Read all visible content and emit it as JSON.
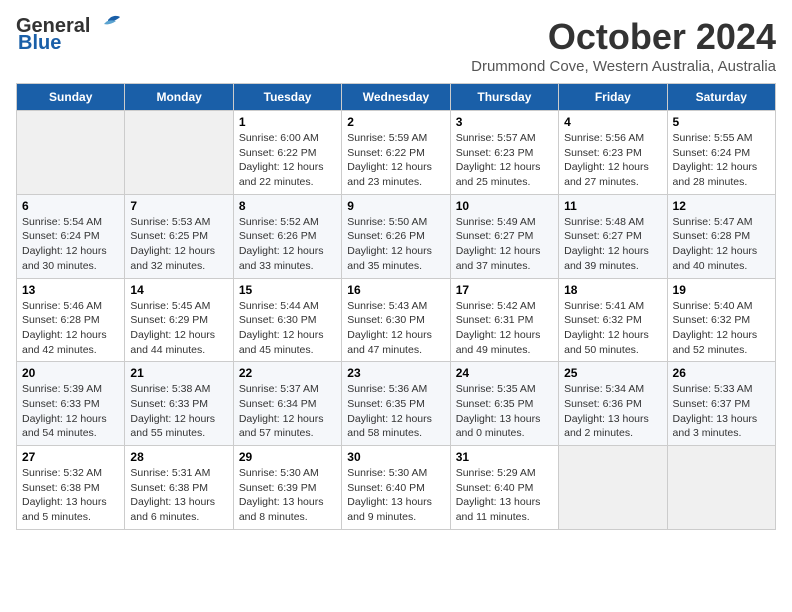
{
  "logo": {
    "line1": "General",
    "line2": "Blue"
  },
  "title": "October 2024",
  "location": "Drummond Cove, Western Australia, Australia",
  "days_header": [
    "Sunday",
    "Monday",
    "Tuesday",
    "Wednesday",
    "Thursday",
    "Friday",
    "Saturday"
  ],
  "weeks": [
    [
      {
        "day": "",
        "info": ""
      },
      {
        "day": "",
        "info": ""
      },
      {
        "day": "1",
        "info": "Sunrise: 6:00 AM\nSunset: 6:22 PM\nDaylight: 12 hours and 22 minutes."
      },
      {
        "day": "2",
        "info": "Sunrise: 5:59 AM\nSunset: 6:22 PM\nDaylight: 12 hours and 23 minutes."
      },
      {
        "day": "3",
        "info": "Sunrise: 5:57 AM\nSunset: 6:23 PM\nDaylight: 12 hours and 25 minutes."
      },
      {
        "day": "4",
        "info": "Sunrise: 5:56 AM\nSunset: 6:23 PM\nDaylight: 12 hours and 27 minutes."
      },
      {
        "day": "5",
        "info": "Sunrise: 5:55 AM\nSunset: 6:24 PM\nDaylight: 12 hours and 28 minutes."
      }
    ],
    [
      {
        "day": "6",
        "info": "Sunrise: 5:54 AM\nSunset: 6:24 PM\nDaylight: 12 hours and 30 minutes."
      },
      {
        "day": "7",
        "info": "Sunrise: 5:53 AM\nSunset: 6:25 PM\nDaylight: 12 hours and 32 minutes."
      },
      {
        "day": "8",
        "info": "Sunrise: 5:52 AM\nSunset: 6:26 PM\nDaylight: 12 hours and 33 minutes."
      },
      {
        "day": "9",
        "info": "Sunrise: 5:50 AM\nSunset: 6:26 PM\nDaylight: 12 hours and 35 minutes."
      },
      {
        "day": "10",
        "info": "Sunrise: 5:49 AM\nSunset: 6:27 PM\nDaylight: 12 hours and 37 minutes."
      },
      {
        "day": "11",
        "info": "Sunrise: 5:48 AM\nSunset: 6:27 PM\nDaylight: 12 hours and 39 minutes."
      },
      {
        "day": "12",
        "info": "Sunrise: 5:47 AM\nSunset: 6:28 PM\nDaylight: 12 hours and 40 minutes."
      }
    ],
    [
      {
        "day": "13",
        "info": "Sunrise: 5:46 AM\nSunset: 6:28 PM\nDaylight: 12 hours and 42 minutes."
      },
      {
        "day": "14",
        "info": "Sunrise: 5:45 AM\nSunset: 6:29 PM\nDaylight: 12 hours and 44 minutes."
      },
      {
        "day": "15",
        "info": "Sunrise: 5:44 AM\nSunset: 6:30 PM\nDaylight: 12 hours and 45 minutes."
      },
      {
        "day": "16",
        "info": "Sunrise: 5:43 AM\nSunset: 6:30 PM\nDaylight: 12 hours and 47 minutes."
      },
      {
        "day": "17",
        "info": "Sunrise: 5:42 AM\nSunset: 6:31 PM\nDaylight: 12 hours and 49 minutes."
      },
      {
        "day": "18",
        "info": "Sunrise: 5:41 AM\nSunset: 6:32 PM\nDaylight: 12 hours and 50 minutes."
      },
      {
        "day": "19",
        "info": "Sunrise: 5:40 AM\nSunset: 6:32 PM\nDaylight: 12 hours and 52 minutes."
      }
    ],
    [
      {
        "day": "20",
        "info": "Sunrise: 5:39 AM\nSunset: 6:33 PM\nDaylight: 12 hours and 54 minutes."
      },
      {
        "day": "21",
        "info": "Sunrise: 5:38 AM\nSunset: 6:33 PM\nDaylight: 12 hours and 55 minutes."
      },
      {
        "day": "22",
        "info": "Sunrise: 5:37 AM\nSunset: 6:34 PM\nDaylight: 12 hours and 57 minutes."
      },
      {
        "day": "23",
        "info": "Sunrise: 5:36 AM\nSunset: 6:35 PM\nDaylight: 12 hours and 58 minutes."
      },
      {
        "day": "24",
        "info": "Sunrise: 5:35 AM\nSunset: 6:35 PM\nDaylight: 13 hours and 0 minutes."
      },
      {
        "day": "25",
        "info": "Sunrise: 5:34 AM\nSunset: 6:36 PM\nDaylight: 13 hours and 2 minutes."
      },
      {
        "day": "26",
        "info": "Sunrise: 5:33 AM\nSunset: 6:37 PM\nDaylight: 13 hours and 3 minutes."
      }
    ],
    [
      {
        "day": "27",
        "info": "Sunrise: 5:32 AM\nSunset: 6:38 PM\nDaylight: 13 hours and 5 minutes."
      },
      {
        "day": "28",
        "info": "Sunrise: 5:31 AM\nSunset: 6:38 PM\nDaylight: 13 hours and 6 minutes."
      },
      {
        "day": "29",
        "info": "Sunrise: 5:30 AM\nSunset: 6:39 PM\nDaylight: 13 hours and 8 minutes."
      },
      {
        "day": "30",
        "info": "Sunrise: 5:30 AM\nSunset: 6:40 PM\nDaylight: 13 hours and 9 minutes."
      },
      {
        "day": "31",
        "info": "Sunrise: 5:29 AM\nSunset: 6:40 PM\nDaylight: 13 hours and 11 minutes."
      },
      {
        "day": "",
        "info": ""
      },
      {
        "day": "",
        "info": ""
      }
    ]
  ]
}
